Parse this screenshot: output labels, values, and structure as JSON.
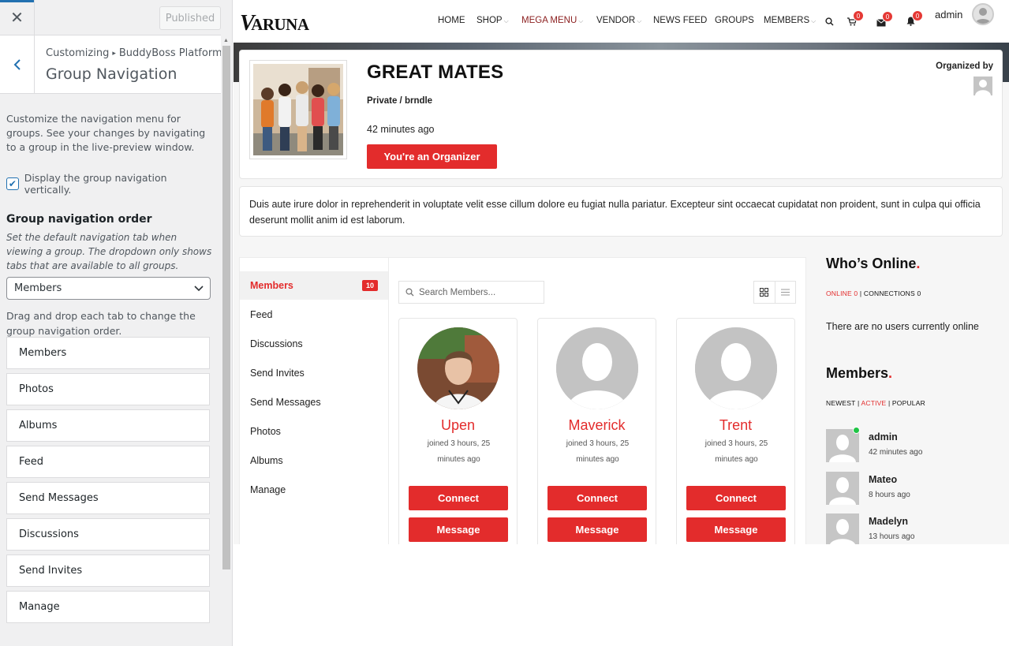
{
  "customizer": {
    "publish_label": "Published",
    "breadcrumb_parent": "Customizing",
    "breadcrumb_section": "BuddyBoss Platform",
    "section_title": "Group Navigation",
    "description": "Customize the navigation menu for groups. See your changes by navigating to a group in the live-preview window.",
    "vertical_label": "Display the group navigation vertically.",
    "vertical_checked": true,
    "order_title": "Group navigation order",
    "order_help": "Set the default navigation tab when viewing a group. The dropdown only shows tabs that are available to all groups.",
    "default_tab": "Members",
    "drag_help": "Drag and drop each tab to change the group navigation order.",
    "tabs": [
      "Members",
      "Photos",
      "Albums",
      "Feed",
      "Send Messages",
      "Discussions",
      "Send Invites",
      "Manage"
    ]
  },
  "site": {
    "logo": "ARUNA",
    "logo_initial": "V",
    "nav": {
      "home": "HOME",
      "shop": "SHOP",
      "mega_menu": "MEGA MENU",
      "vendor": "VENDOR",
      "news_feed": "NEWS FEED",
      "groups": "GROUPS",
      "members": "MEMBERS"
    },
    "cart_count": "0",
    "messages_count": "0",
    "notifications_count": "0",
    "username": "admin"
  },
  "group": {
    "name": "GREAT MATES",
    "status": "Private / brndle",
    "activity": "42 minutes ago",
    "organizer_button": "You're an Organizer",
    "organized_by": "Organized by",
    "description": "Duis aute irure dolor in reprehenderit in voluptate velit esse cillum dolore eu fugiat nulla pariatur. Excepteur sint occaecat cupidatat non proident, sunt in culpa qui officia deserunt mollit anim id est laborum."
  },
  "group_nav": {
    "members": "Members",
    "members_count": "10",
    "feed": "Feed",
    "discussions": "Discussions",
    "send_invites": "Send Invites",
    "send_messages": "Send Messages",
    "photos": "Photos",
    "albums": "Albums",
    "manage": "Manage"
  },
  "members_dir": {
    "search_placeholder": "Search Members...",
    "connect_label": "Connect",
    "message_label": "Message",
    "cards": [
      {
        "name": "Upen",
        "joined": "joined 3 hours, 25 minutes ago"
      },
      {
        "name": "Maverick",
        "joined": "joined 3 hours, 25 minutes ago"
      },
      {
        "name": "Trent",
        "joined": "joined 3 hours, 25 minutes ago"
      }
    ]
  },
  "widgets": {
    "online": {
      "title": "Who’s Online",
      "tab_online": "ONLINE 0",
      "tab_connections": "CONNECTIONS 0",
      "empty": "There are no users currently online"
    },
    "members": {
      "title": "Members",
      "tab_newest": "NEWEST",
      "tab_active": "ACTIVE",
      "tab_popular": "POPULAR",
      "list": [
        {
          "name": "admin",
          "time": "42 minutes ago"
        },
        {
          "name": "Mateo",
          "time": "8 hours ago"
        },
        {
          "name": "Madelyn",
          "time": "13 hours ago"
        }
      ]
    }
  },
  "colors": {
    "accent": "#e32c2c",
    "wp_blue": "#2271b1",
    "online": "#1fc445"
  }
}
